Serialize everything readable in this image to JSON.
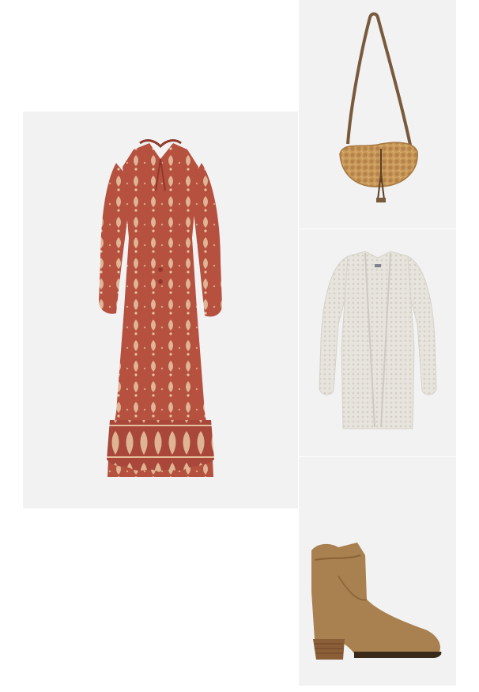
{
  "collage": {
    "items": [
      {
        "name": "dress",
        "main_color": "#b5513e",
        "pattern_color": "#e8c6a3"
      },
      {
        "name": "bag",
        "main_color": "#c99a5a",
        "strap_color": "#7a5a3c"
      },
      {
        "name": "cardigan",
        "main_color": "#e7e4dd"
      },
      {
        "name": "boot",
        "main_color": "#a9804f",
        "heel_color": "#8a5e37"
      }
    ],
    "tile_background": "#f2f2f2",
    "page_background": "#ffffff"
  }
}
